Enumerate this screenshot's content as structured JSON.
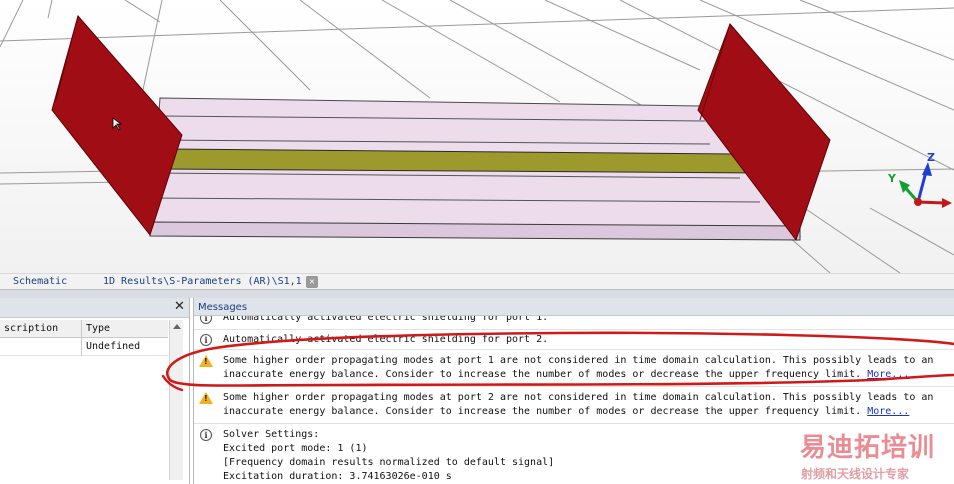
{
  "tabs": [
    {
      "label": "Schematic"
    },
    {
      "label": "1D Results\\S-Parameters (AR)\\S1,1"
    }
  ],
  "tab_close_glyph": "✕",
  "left_panel": {
    "close_glyph": "✕",
    "columns": [
      "scription",
      "Type"
    ],
    "rows": [
      [
        "",
        "Undefined"
      ]
    ]
  },
  "axes": {
    "z": "Z",
    "y": "Y"
  },
  "messages": {
    "title": "Messages",
    "items": [
      {
        "type": "info",
        "lines": [
          "Automatically activated electric shielding for port 1."
        ]
      },
      {
        "type": "info",
        "lines": [
          "Automatically activated electric shielding for port 2."
        ]
      },
      {
        "type": "warning",
        "lines": [
          "Some higher order propagating modes at port 1 are not considered in time domain calculation. This possibly leads to an",
          "inaccurate energy balance. Consider to increase the number of modes or decrease the upper frequency limit."
        ],
        "link": "More..."
      },
      {
        "type": "warning",
        "lines": [
          "Some higher order propagating modes at port 2 are not considered in time domain calculation. This possibly leads to an",
          "inaccurate energy balance. Consider to increase the number of modes or decrease the upper frequency limit."
        ],
        "link": "More..."
      },
      {
        "type": "info",
        "lines": [
          "Solver Settings:",
          "Excited port mode: 1 (1)",
          "[Frequency domain results normalized to default signal]",
          "Excitation duration: 3.74163026e-010 s"
        ]
      }
    ]
  },
  "watermark": {
    "title": "易迪拓培训",
    "subtitle": "射频和天线设计专家"
  },
  "colors": {
    "port": "#a00d14",
    "strip": "#9c9a2c",
    "substrate": "#ecdcec",
    "annotation": "#d01a1a"
  }
}
